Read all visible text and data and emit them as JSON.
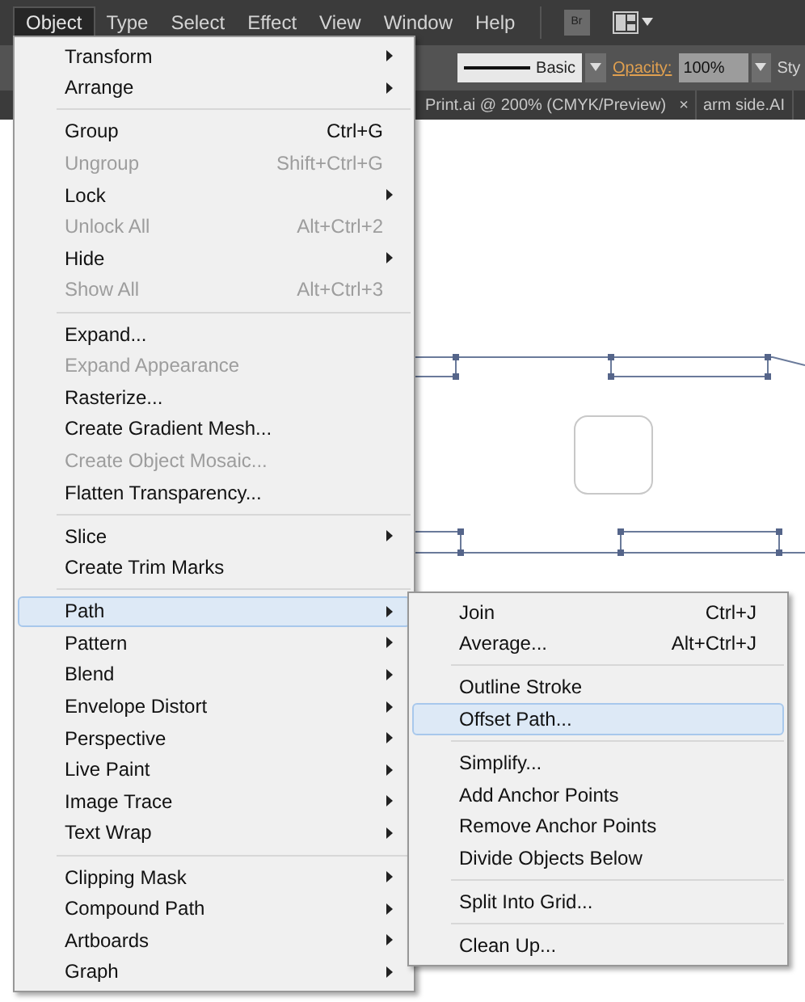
{
  "menubar": {
    "items": [
      {
        "label": "Object",
        "selected": true
      },
      {
        "label": "Type",
        "selected": false
      },
      {
        "label": "Select",
        "selected": false
      },
      {
        "label": "Effect",
        "selected": false
      },
      {
        "label": "View",
        "selected": false
      },
      {
        "label": "Window",
        "selected": false
      },
      {
        "label": "Help",
        "selected": false
      }
    ],
    "bridge_label": "Br"
  },
  "control_bar": {
    "stroke_style": "Basic",
    "opacity_label": "Opacity:",
    "opacity_value": "100%",
    "cut_label": "Sty"
  },
  "document_tabs": [
    {
      "label": "Print.ai @ 200% (CMYK/Preview)",
      "close": "×"
    },
    {
      "label": "arm side.AI"
    }
  ],
  "object_menu": {
    "items": [
      {
        "kind": "item",
        "label": "Transform",
        "submenu": true,
        "disabled": false,
        "selected": false
      },
      {
        "kind": "item",
        "label": "Arrange",
        "submenu": true,
        "disabled": false,
        "selected": false
      },
      {
        "kind": "separator"
      },
      {
        "kind": "item",
        "label": "Group",
        "shortcut": "Ctrl+G",
        "submenu": false,
        "disabled": false,
        "selected": false
      },
      {
        "kind": "item",
        "label": "Ungroup",
        "shortcut": "Shift+Ctrl+G",
        "submenu": false,
        "disabled": true,
        "selected": false
      },
      {
        "kind": "item",
        "label": "Lock",
        "submenu": true,
        "disabled": false,
        "selected": false
      },
      {
        "kind": "item",
        "label": "Unlock All",
        "shortcut": "Alt+Ctrl+2",
        "submenu": false,
        "disabled": true,
        "selected": false
      },
      {
        "kind": "item",
        "label": "Hide",
        "submenu": true,
        "disabled": false,
        "selected": false
      },
      {
        "kind": "item",
        "label": "Show All",
        "shortcut": "Alt+Ctrl+3",
        "submenu": false,
        "disabled": true,
        "selected": false
      },
      {
        "kind": "separator"
      },
      {
        "kind": "item",
        "label": "Expand...",
        "submenu": false,
        "disabled": false,
        "selected": false
      },
      {
        "kind": "item",
        "label": "Expand Appearance",
        "submenu": false,
        "disabled": true,
        "selected": false
      },
      {
        "kind": "item",
        "label": "Rasterize...",
        "submenu": false,
        "disabled": false,
        "selected": false
      },
      {
        "kind": "item",
        "label": "Create Gradient Mesh...",
        "submenu": false,
        "disabled": false,
        "selected": false
      },
      {
        "kind": "item",
        "label": "Create Object Mosaic...",
        "submenu": false,
        "disabled": true,
        "selected": false
      },
      {
        "kind": "item",
        "label": "Flatten Transparency...",
        "submenu": false,
        "disabled": false,
        "selected": false
      },
      {
        "kind": "separator"
      },
      {
        "kind": "item",
        "label": "Slice",
        "submenu": true,
        "disabled": false,
        "selected": false
      },
      {
        "kind": "item",
        "label": "Create Trim Marks",
        "submenu": false,
        "disabled": false,
        "selected": false
      },
      {
        "kind": "separator"
      },
      {
        "kind": "item",
        "label": "Path",
        "submenu": true,
        "disabled": false,
        "selected": true
      },
      {
        "kind": "item",
        "label": "Pattern",
        "submenu": true,
        "disabled": false,
        "selected": false
      },
      {
        "kind": "item",
        "label": "Blend",
        "submenu": true,
        "disabled": false,
        "selected": false
      },
      {
        "kind": "item",
        "label": "Envelope Distort",
        "submenu": true,
        "disabled": false,
        "selected": false
      },
      {
        "kind": "item",
        "label": "Perspective",
        "submenu": true,
        "disabled": false,
        "selected": false
      },
      {
        "kind": "item",
        "label": "Live Paint",
        "submenu": true,
        "disabled": false,
        "selected": false
      },
      {
        "kind": "item",
        "label": "Image Trace",
        "submenu": true,
        "disabled": false,
        "selected": false
      },
      {
        "kind": "item",
        "label": "Text Wrap",
        "submenu": true,
        "disabled": false,
        "selected": false
      },
      {
        "kind": "separator"
      },
      {
        "kind": "item",
        "label": "Clipping Mask",
        "submenu": true,
        "disabled": false,
        "selected": false
      },
      {
        "kind": "item",
        "label": "Compound Path",
        "submenu": true,
        "disabled": false,
        "selected": false
      },
      {
        "kind": "item",
        "label": "Artboards",
        "submenu": true,
        "disabled": false,
        "selected": false
      },
      {
        "kind": "item",
        "label": "Graph",
        "submenu": true,
        "disabled": false,
        "selected": false
      }
    ]
  },
  "path_submenu": {
    "items": [
      {
        "kind": "item",
        "label": "Join",
        "shortcut": "Ctrl+J",
        "submenu": false,
        "disabled": false,
        "selected": false
      },
      {
        "kind": "item",
        "label": "Average...",
        "shortcut": "Alt+Ctrl+J",
        "submenu": false,
        "disabled": false,
        "selected": false
      },
      {
        "kind": "separator"
      },
      {
        "kind": "item",
        "label": "Outline Stroke",
        "submenu": false,
        "disabled": false,
        "selected": false
      },
      {
        "kind": "item",
        "label": "Offset Path...",
        "submenu": false,
        "disabled": false,
        "selected": true
      },
      {
        "kind": "separator"
      },
      {
        "kind": "item",
        "label": "Simplify...",
        "submenu": false,
        "disabled": false,
        "selected": false
      },
      {
        "kind": "item",
        "label": "Add Anchor Points",
        "submenu": false,
        "disabled": false,
        "selected": false
      },
      {
        "kind": "item",
        "label": "Remove Anchor Points",
        "submenu": false,
        "disabled": false,
        "selected": false
      },
      {
        "kind": "item",
        "label": "Divide Objects Below",
        "submenu": false,
        "disabled": false,
        "selected": false
      },
      {
        "kind": "separator"
      },
      {
        "kind": "item",
        "label": "Split Into Grid...",
        "submenu": false,
        "disabled": false,
        "selected": false
      },
      {
        "kind": "separator"
      },
      {
        "kind": "item",
        "label": "Clean Up...",
        "submenu": false,
        "disabled": false,
        "selected": false
      }
    ]
  }
}
